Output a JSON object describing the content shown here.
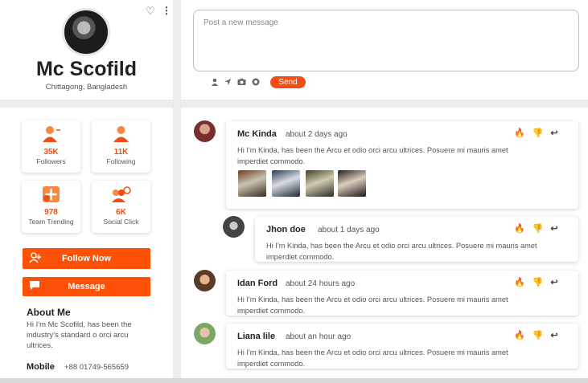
{
  "profile": {
    "name": "Mc Scofild",
    "location": "Chittagong, Bangladesh"
  },
  "composer": {
    "placeholder": "Post a new message",
    "send_label": "Send"
  },
  "stats": [
    {
      "value": "35K",
      "label": "Followers"
    },
    {
      "value": "11K",
      "label": "Following"
    },
    {
      "value": "978",
      "label": "Team Trending"
    },
    {
      "value": "6K",
      "label": "Social Click"
    }
  ],
  "actions": {
    "follow_label": "Follow Now",
    "message_label": "Message"
  },
  "about": {
    "title": "About Me",
    "text": "Hi I'm Mc Scofild, has been the industry's standard o orci arcu ultrices.",
    "mobile_label": "Mobile",
    "mobile_value": "+88 01749-565659"
  },
  "posts": [
    {
      "name": "Mc Kinda",
      "time": "about 2 days ago",
      "text_line1": "Hi I'm Kinda, has been the Arcu et odio orci arcu ultrices. Posuere mi mauris amet",
      "text_line2": "imperdiet commodo."
    },
    {
      "name": "Jhon doe",
      "time": "about 1 days ago",
      "text_line1": "Hi I'm Kinda, has been the Arcu et odio orci arcu ultrices. Posuere mi mauris amet",
      "text_line2": "imperdiet commodo."
    },
    {
      "name": "Idan Ford",
      "time": "about 24 hours ago",
      "text_line1": "Hi I'm Kinda, has been the Arcu et odio orci arcu ultrices. Posuere mi mauris amet",
      "text_line2": "imperdiet commodo."
    },
    {
      "name": "Liana lile",
      "time": "about an hour ago",
      "text_line1": "Hi I'm Kinda, has been the Arcu et odio orci arcu ultrices. Posuere mi mauris amet",
      "text_line2": "imperdiet commodo."
    }
  ],
  "icons": {
    "heart": "heart-icon",
    "more": "more-icon",
    "like": "flame-icon",
    "dislike": "thumbs-down-icon",
    "reply": "reply-icon"
  },
  "colors": {
    "accent": "#fe5108"
  }
}
